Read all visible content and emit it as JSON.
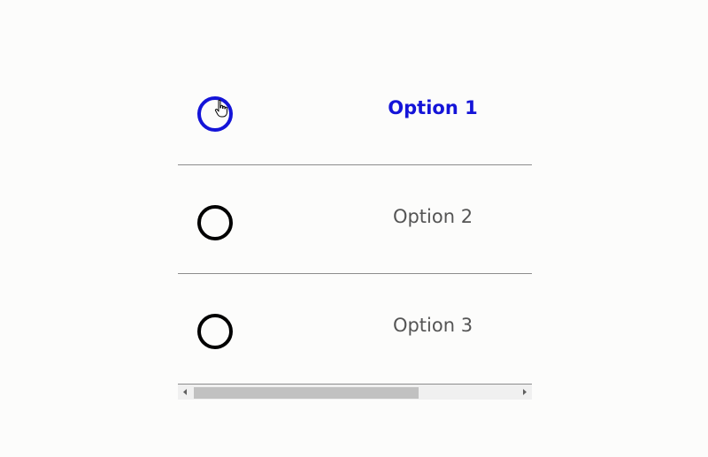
{
  "options": [
    {
      "label": "Option 1",
      "selected": true
    },
    {
      "label": "Option 2",
      "selected": false
    },
    {
      "label": "Option 3",
      "selected": false
    }
  ],
  "colors": {
    "accent": "#1414d8",
    "radio_default": "#000000",
    "label_default": "#555555",
    "divider": "#8c8c8c",
    "scroll_thumb": "#c1c1c1",
    "scroll_track": "#f0f0f0",
    "background": "#fcfcfb"
  },
  "icons": {
    "cursor": "hand-pointer-icon",
    "scroll_left": "scroll-left-arrow-icon",
    "scroll_right": "scroll-right-arrow-icon"
  }
}
